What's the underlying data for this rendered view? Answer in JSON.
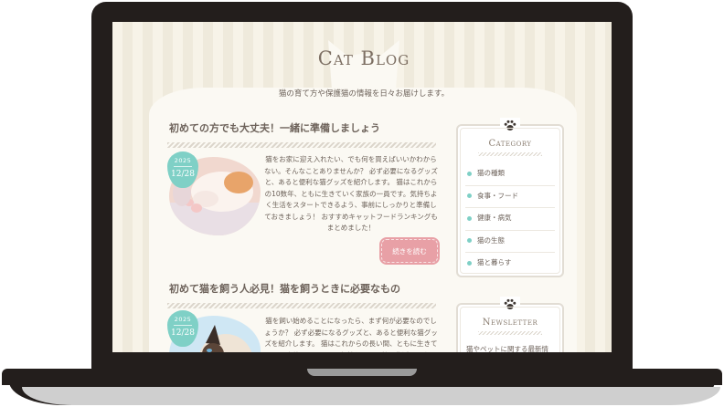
{
  "site": {
    "title": "Cat Blog",
    "description": "猫の育て方や保護猫の情報を日々お届けします。"
  },
  "posts": [
    {
      "title": "初めての方でも大丈夫！一緒に準備しましょう",
      "date_year": "2025",
      "date_md": "12/28",
      "excerpt": "猫をお家に迎え入れたい、でも何を買えばいいかわからない。そんなことありませんか？ 必ず必要になるグッズと、あると便利な猫グッズを紹介します。 猫はこれからの10数年、ともに生きていく家族の一員です。気持ちよく生活をスタートできるよう、事前にしっかりと準備しておきましょう！ おすすめキャットフードランキングもまとめました！",
      "more_label": "続きを読む"
    },
    {
      "title": "初めて猫を飼う人必見！猫を飼うときに必要なもの",
      "date_year": "2025",
      "date_md": "12/28",
      "excerpt": "猫を飼い始めることになったら、まず何が必要なのでしょうか？ 必ず必要になるグッズと、あると便利な猫グッズを紹介します。 猫はこれからの長い間、ともに生きていく家族の一員です。気持ちよく一緒に生活をスタ"
    }
  ],
  "sidebar": {
    "category": {
      "title": "Category",
      "items": [
        "猫の種類",
        "食事・フード",
        "健康・病気",
        "猫の生態",
        "猫と暮らす"
      ]
    },
    "newsletter": {
      "title": "Newsletter",
      "text": "猫やペットに関する最新情報、お知らせ等を配信中！お"
    }
  },
  "colors": {
    "accent_mint": "#7fd0c6",
    "button_pink": "#e8a0a6",
    "text_brown": "#6d625a"
  },
  "icons": {
    "widget_header": "paw-icon",
    "title_decoration": "cat-head-icon"
  }
}
